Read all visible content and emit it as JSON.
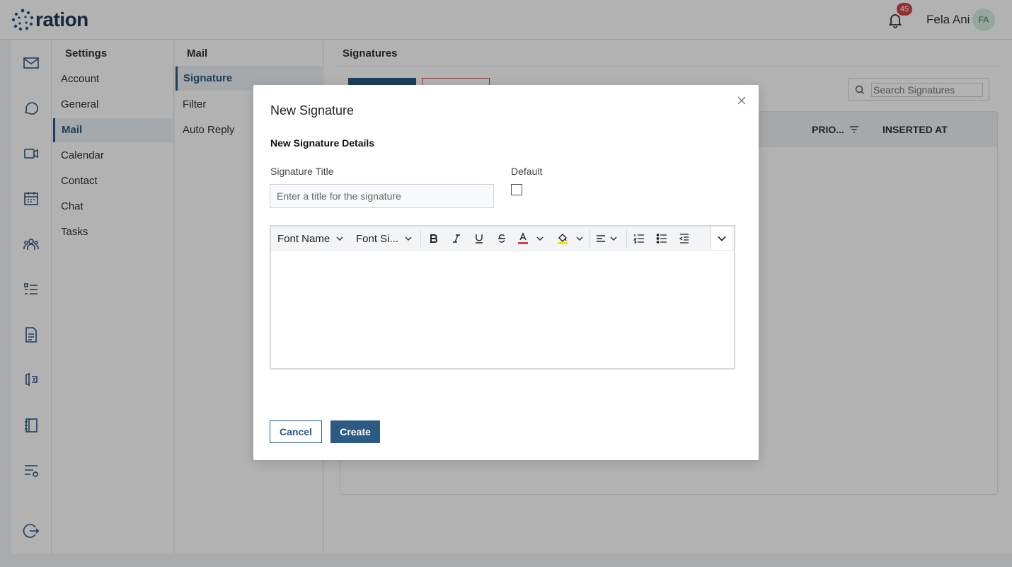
{
  "header": {
    "logo_text": "ration",
    "notification_count": "45",
    "user_name": "Fela Ani",
    "user_initials": "FA"
  },
  "rail": {
    "icons": [
      "mail-icon",
      "chat-icon",
      "video-icon",
      "calendar-icon",
      "contacts-icon",
      "tasks-icon",
      "document-icon",
      "forms-icon",
      "notebook-icon",
      "settings-list-icon",
      "logout-icon"
    ]
  },
  "settings": {
    "title": "Settings",
    "items": [
      "Account",
      "General",
      "Mail",
      "Calendar",
      "Contact",
      "Chat",
      "Tasks"
    ],
    "active": "Mail"
  },
  "mail": {
    "title": "Mail",
    "items": [
      "Signature",
      "Filter",
      "Auto Reply"
    ],
    "active": "Signature"
  },
  "signatures": {
    "title": "Signatures",
    "search_placeholder": "Search Signatures",
    "columns": [
      "PRIO...",
      "INSERTED AT"
    ]
  },
  "modal": {
    "title": "New Signature",
    "section_title": "New Signature Details",
    "signature_title_label": "Signature Title",
    "signature_title_placeholder": "Enter a title for the signature",
    "default_label": "Default",
    "toolbar": {
      "font_name": "Font Name",
      "font_size": "Font Si..."
    },
    "cancel_label": "Cancel",
    "create_label": "Create"
  },
  "colors": {
    "brand": "#2b5a83",
    "badge": "#d64545",
    "text_color_underline": "#d64545",
    "highlight_underline": "#f2e400"
  }
}
